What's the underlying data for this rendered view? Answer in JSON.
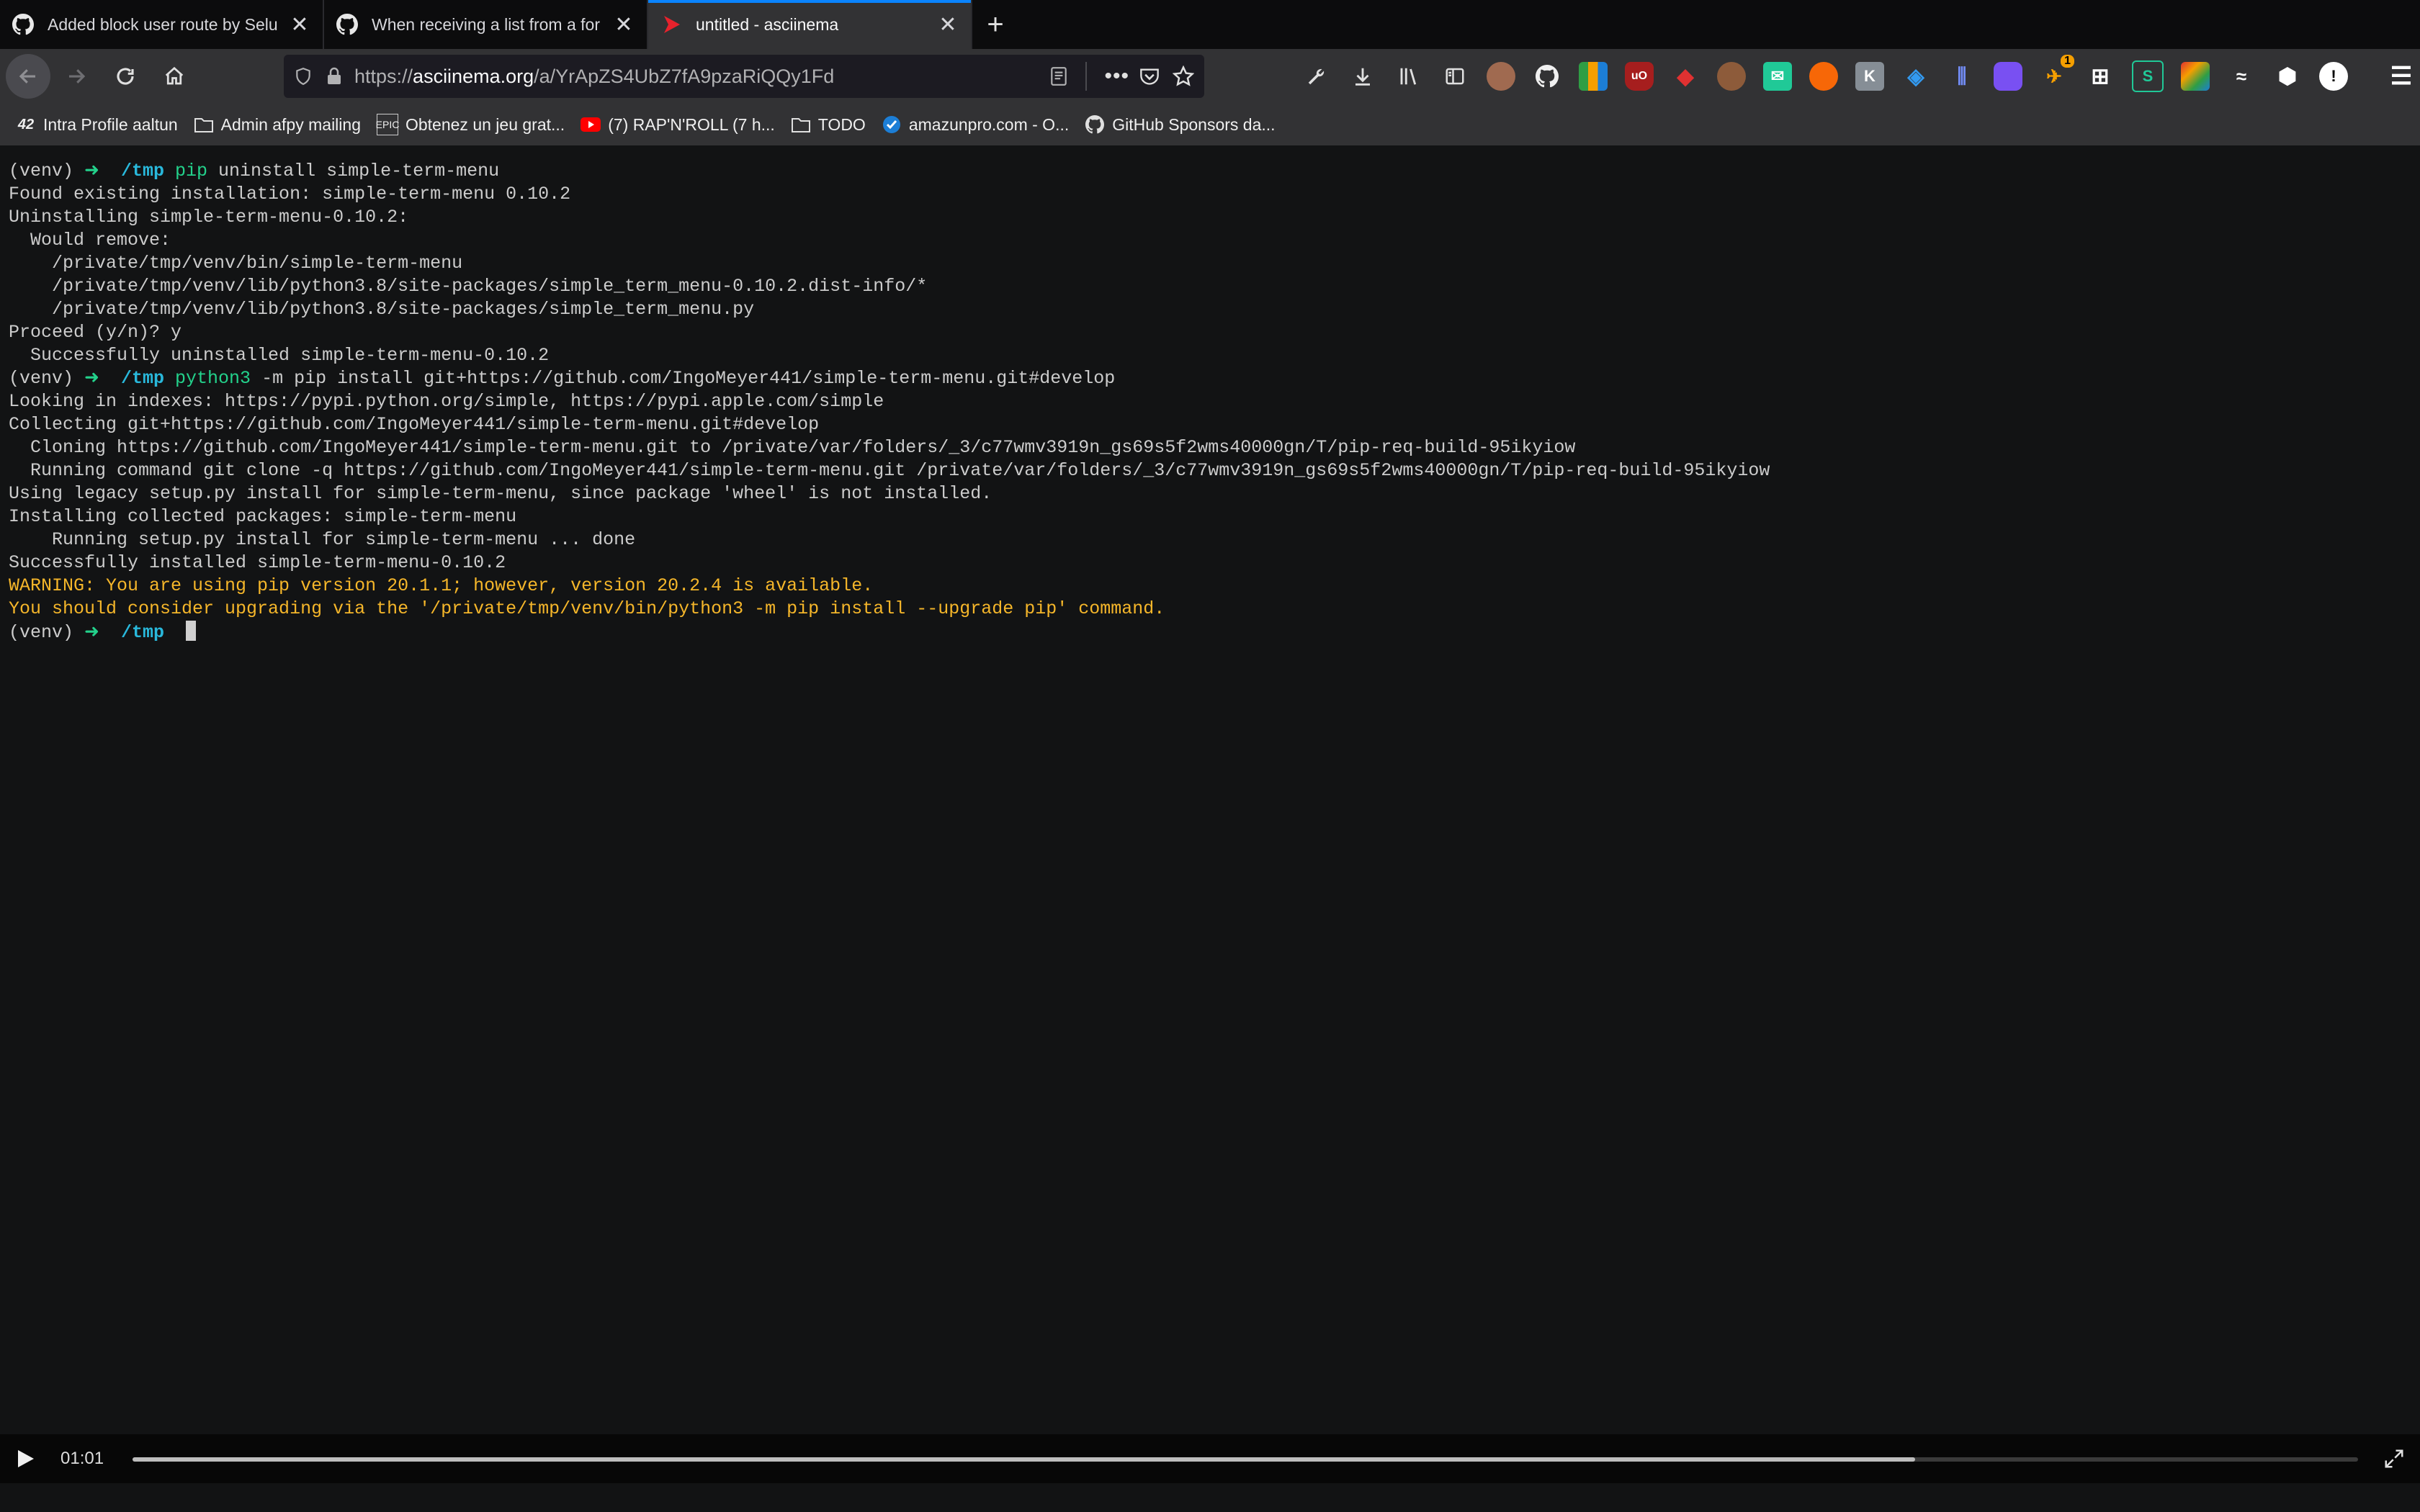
{
  "tabs": [
    {
      "title": "Added block user route by Selu",
      "icon": "github-icon",
      "active": false
    },
    {
      "title": "When receiving a list from a for",
      "icon": "github-icon",
      "active": false
    },
    {
      "title": "untitled - asciinema",
      "icon": "asciinema-icon",
      "active": true
    }
  ],
  "new_tab_label": "+",
  "url": {
    "prefix": "https://",
    "host": "asciinema.org",
    "path": "/a/YrApZS4UbZ7fA9pzaRiQQy1Fd"
  },
  "bookmarks": [
    {
      "label": "Intra Profile aaltun",
      "icon": "42-icon"
    },
    {
      "label": "Admin afpy mailing",
      "icon": "folder-icon"
    },
    {
      "label": "Obtenez un jeu grat...",
      "icon": "epic-icon"
    },
    {
      "label": "(7) RAP'N'ROLL (7 h...",
      "icon": "youtube-icon"
    },
    {
      "label": "TODO",
      "icon": "folder-icon"
    },
    {
      "label": "amazunpro.com - O...",
      "icon": "globe-icon"
    },
    {
      "label": "GitHub Sponsors da...",
      "icon": "github-icon"
    }
  ],
  "toolbar_badge": "1",
  "terminal": {
    "lines": [
      {
        "type": "prompt",
        "venv": "(venv)",
        "arrow": "➜",
        "cwd": "/tmp",
        "cmd": "pip",
        "args": " uninstall simple-term-menu"
      },
      {
        "type": "text",
        "text": "Found existing installation: simple-term-menu 0.10.2"
      },
      {
        "type": "text",
        "text": "Uninstalling simple-term-menu-0.10.2:"
      },
      {
        "type": "text",
        "text": "  Would remove:"
      },
      {
        "type": "text",
        "text": "    /private/tmp/venv/bin/simple-term-menu"
      },
      {
        "type": "text",
        "text": "    /private/tmp/venv/lib/python3.8/site-packages/simple_term_menu-0.10.2.dist-info/*"
      },
      {
        "type": "text",
        "text": "    /private/tmp/venv/lib/python3.8/site-packages/simple_term_menu.py"
      },
      {
        "type": "text",
        "text": "Proceed (y/n)? y"
      },
      {
        "type": "text",
        "text": "  Successfully uninstalled simple-term-menu-0.10.2"
      },
      {
        "type": "prompt",
        "venv": "(venv)",
        "arrow": "➜",
        "cwd": "/tmp",
        "cmd": "python3",
        "args": " -m pip install git+https://github.com/IngoMeyer441/simple-term-menu.git#develop"
      },
      {
        "type": "text",
        "text": "Looking in indexes: https://pypi.python.org/simple, https://pypi.apple.com/simple"
      },
      {
        "type": "text",
        "text": "Collecting git+https://github.com/IngoMeyer441/simple-term-menu.git#develop"
      },
      {
        "type": "text",
        "text": "  Cloning https://github.com/IngoMeyer441/simple-term-menu.git to /private/var/folders/_3/c77wmv3919n_gs69s5f2wms40000gn/T/pip-req-build-95ikyiow"
      },
      {
        "type": "text",
        "text": "  Running command git clone -q https://github.com/IngoMeyer441/simple-term-menu.git /private/var/folders/_3/c77wmv3919n_gs69s5f2wms40000gn/T/pip-req-build-95ikyiow"
      },
      {
        "type": "text",
        "text": "Using legacy setup.py install for simple-term-menu, since package 'wheel' is not installed."
      },
      {
        "type": "text",
        "text": "Installing collected packages: simple-term-menu"
      },
      {
        "type": "text",
        "text": "    Running setup.py install for simple-term-menu ... done"
      },
      {
        "type": "text",
        "text": "Successfully installed simple-term-menu-0.10.2"
      },
      {
        "type": "warn",
        "text": "WARNING: You are using pip version 20.1.1; however, version 20.2.4 is available."
      },
      {
        "type": "warn",
        "text": "You should consider upgrading via the '/private/tmp/venv/bin/python3 -m pip install --upgrade pip' command."
      },
      {
        "type": "prompt",
        "venv": "(venv)",
        "arrow": "➜",
        "cwd": "/tmp",
        "cmd": "",
        "args": " ",
        "cursor": true
      }
    ]
  },
  "player": {
    "time": "01:01",
    "progress_fraction": 0.801
  },
  "colors": {
    "accent": "#0a84ff",
    "prompt_green": "#23d18b",
    "cwd_cyan": "#29b8db",
    "warning": "#f5b62a"
  }
}
